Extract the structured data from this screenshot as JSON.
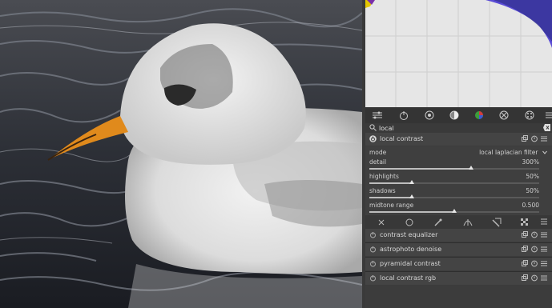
{
  "search": {
    "value": "local",
    "placeholder": ""
  },
  "modules": [
    {
      "title": "local contrast",
      "expanded": true
    },
    {
      "title": "contrast equalizer"
    },
    {
      "title": "astrophoto denoise"
    },
    {
      "title": "pyramidal contrast"
    },
    {
      "title": "local contrast rgb"
    }
  ],
  "local_contrast": {
    "mode_label": "mode",
    "mode_value": "local laplacian filter",
    "detail": {
      "label": "detail",
      "value": "300%",
      "fraction": 0.6
    },
    "highlights": {
      "label": "highlights",
      "value": "50%",
      "fraction": 0.25
    },
    "shadows": {
      "label": "shadows",
      "value": "50%",
      "fraction": 0.25
    },
    "midtone_range": {
      "label": "midtone range",
      "value": "0.500",
      "fraction": 0.5
    }
  },
  "colors": {
    "panel": "#3c3c3c",
    "histogram_bg": "#e6e6e6",
    "accent": "#5a4bd6"
  }
}
